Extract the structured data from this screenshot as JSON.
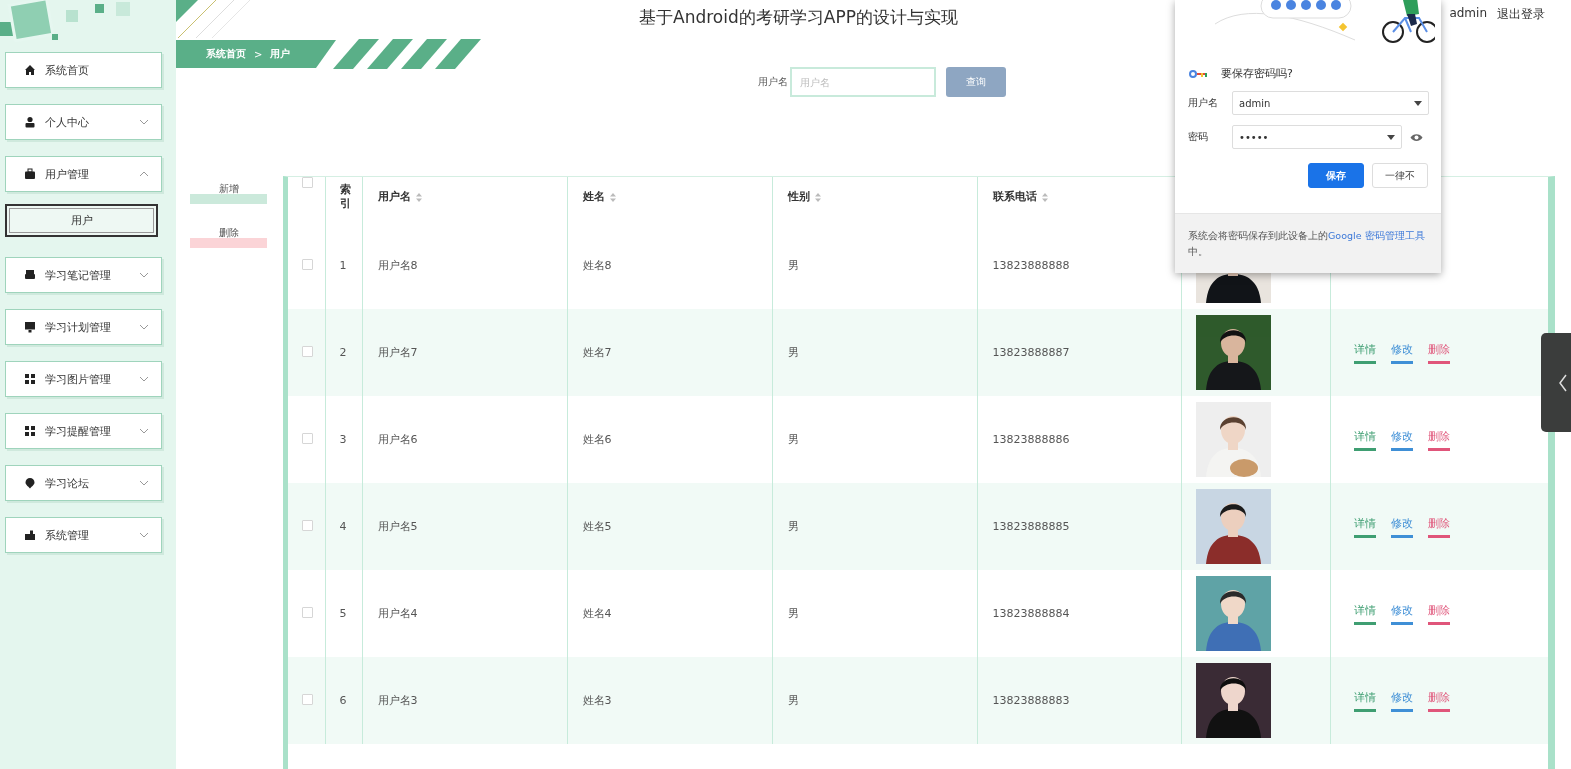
{
  "app": {
    "title": "基于Android的考研学习APP的设计与实现",
    "user": "admin",
    "logout": "退出登录"
  },
  "sidebar": {
    "items": [
      {
        "label": "系统首页"
      },
      {
        "label": "个人中心",
        "expanded": false
      },
      {
        "label": "用户管理",
        "expanded": true,
        "children": [
          {
            "label": "用户",
            "selected": true
          }
        ]
      },
      {
        "label": "学习笔记管理",
        "expanded": false
      },
      {
        "label": "学习计划管理",
        "expanded": false
      },
      {
        "label": "学习图片管理",
        "expanded": false
      },
      {
        "label": "学习提醒管理",
        "expanded": false
      },
      {
        "label": "学习论坛",
        "expanded": false
      },
      {
        "label": "系统管理",
        "expanded": false
      }
    ]
  },
  "breadcrumb": {
    "items": [
      "系统首页",
      "用户"
    ],
    "separator": ">"
  },
  "search": {
    "label": "用户名",
    "placeholder": "用户名",
    "button": "查询"
  },
  "actions": [
    {
      "label": "新增",
      "kind": "add"
    },
    {
      "label": "删除",
      "kind": "delete"
    }
  ],
  "table": {
    "header_checked": false,
    "columns": [
      {
        "label": "索引",
        "sortable": false
      },
      {
        "label": "用户名",
        "sortable": true
      },
      {
        "label": "姓名",
        "sortable": true
      },
      {
        "label": "性别",
        "sortable": true
      },
      {
        "label": "联系电话",
        "sortable": true
      }
    ],
    "rows": [
      {
        "checked": false,
        "index": "1",
        "username": "用户名8",
        "name": "姓名8",
        "gender": "男",
        "phone": "13823888888",
        "avatar": {
          "kind": "picture"
        },
        "actions": []
      },
      {
        "checked": false,
        "index": "2",
        "username": "用户名7",
        "name": "姓名7",
        "gender": "男",
        "phone": "13823888887",
        "avatar": {
          "kind": "picture"
        },
        "actions": [
          {
            "label": "详情",
            "kind": "detail"
          },
          {
            "label": "修改",
            "kind": "edit"
          },
          {
            "label": "删除",
            "kind": "delete"
          }
        ]
      },
      {
        "checked": false,
        "index": "3",
        "username": "用户名6",
        "name": "姓名6",
        "gender": "男",
        "phone": "13823888886",
        "avatar": {
          "kind": "picture"
        },
        "actions": [
          {
            "label": "详情",
            "kind": "detail"
          },
          {
            "label": "修改",
            "kind": "edit"
          },
          {
            "label": "删除",
            "kind": "delete"
          }
        ]
      },
      {
        "checked": false,
        "index": "4",
        "username": "用户名5",
        "name": "姓名5",
        "gender": "男",
        "phone": "13823888885",
        "avatar": {
          "kind": "picture"
        },
        "actions": [
          {
            "label": "详情",
            "kind": "detail"
          },
          {
            "label": "修改",
            "kind": "edit"
          },
          {
            "label": "删除",
            "kind": "delete"
          }
        ]
      },
      {
        "checked": false,
        "index": "5",
        "username": "用户名4",
        "name": "姓名4",
        "gender": "男",
        "phone": "13823888884",
        "avatar": {
          "kind": "picture"
        },
        "actions": [
          {
            "label": "详情",
            "kind": "detail"
          },
          {
            "label": "修改",
            "kind": "edit"
          },
          {
            "label": "删除",
            "kind": "delete"
          }
        ]
      },
      {
        "checked": false,
        "index": "6",
        "username": "用户名3",
        "name": "姓名3",
        "gender": "男",
        "phone": "13823888883",
        "avatar": {
          "kind": "picture"
        },
        "actions": [
          {
            "label": "详情",
            "kind": "detail"
          },
          {
            "label": "修改",
            "kind": "edit"
          },
          {
            "label": "删除",
            "kind": "delete"
          }
        ]
      }
    ]
  },
  "password_popup": {
    "title": "要保存密码吗?",
    "fields": [
      {
        "label": "用户名",
        "value": "admin",
        "kind": "text"
      },
      {
        "label": "密码",
        "value": "•••••",
        "kind": "password"
      }
    ],
    "buttons": [
      {
        "label": "保存",
        "kind": "primary"
      },
      {
        "label": "一律不",
        "kind": "secondary"
      }
    ],
    "footer": {
      "text": "系统会将密码保存到此设备上的",
      "link": "Google 密码管理工具",
      "after": "中。"
    }
  }
}
